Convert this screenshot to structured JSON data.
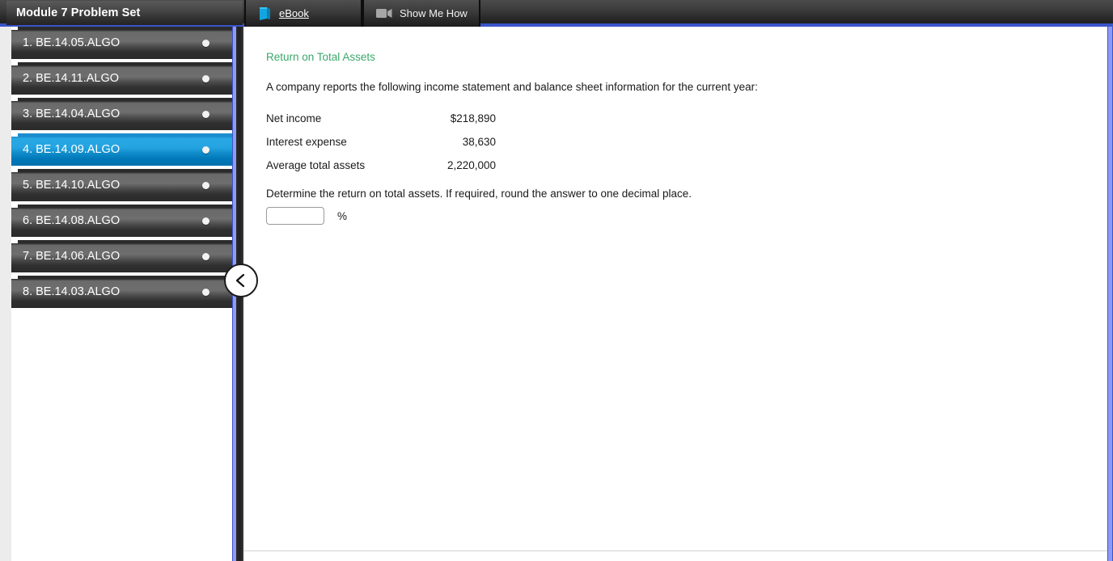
{
  "window": {
    "module_title": "Module 7 Problem Set"
  },
  "tabs": [
    {
      "id": "ebook",
      "label": "eBook",
      "icon": "book-icon"
    },
    {
      "id": "show_me_how",
      "label": "Show Me How",
      "icon": "video-camera-icon"
    }
  ],
  "sidebar": {
    "items": [
      {
        "label": "1. BE.14.05.ALGO",
        "active": false
      },
      {
        "label": "2. BE.14.11.ALGO",
        "active": false
      },
      {
        "label": "3. BE.14.04.ALGO",
        "active": false
      },
      {
        "label": "4. BE.14.09.ALGO",
        "active": true
      },
      {
        "label": "5. BE.14.10.ALGO",
        "active": false
      },
      {
        "label": "6. BE.14.08.ALGO",
        "active": false
      },
      {
        "label": "7. BE.14.06.ALGO",
        "active": false
      },
      {
        "label": "8. BE.14.03.ALGO",
        "active": false
      }
    ],
    "collapse_handle": "‹"
  },
  "problem": {
    "heading": "Return on Total Assets",
    "intro": "A company reports the following income statement and balance sheet information for the current year:",
    "facts": [
      {
        "label": "Net income",
        "value": "$218,890"
      },
      {
        "label": "Interest expense",
        "value": "38,630"
      },
      {
        "label": "Average total assets",
        "value": "2,220,000"
      }
    ],
    "question": "Determine the return on total assets. If required, round the answer to one decimal place.",
    "answer_value": "",
    "answer_placeholder": "",
    "answer_unit": "%"
  },
  "colors": {
    "accent_blue": "#29a8e4",
    "heading_green": "#3aa86a",
    "scrollbar_blue": "#8f9af5",
    "topbar_underline": "#3a54c8"
  }
}
